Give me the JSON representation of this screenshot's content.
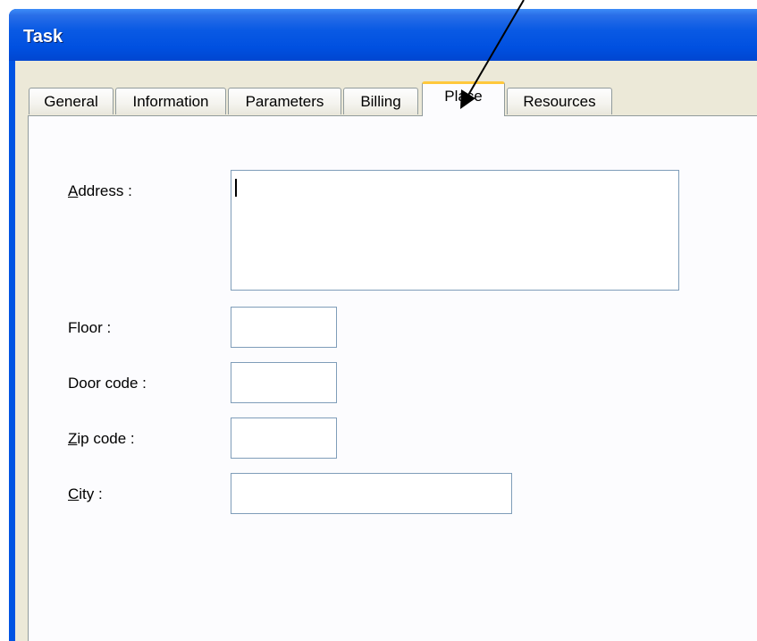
{
  "window": {
    "title": "Task"
  },
  "tabs": [
    {
      "label": "General"
    },
    {
      "label": "Information"
    },
    {
      "label": "Parameters"
    },
    {
      "label": "Billing"
    },
    {
      "label": "Place",
      "active": true
    },
    {
      "label": "Resources"
    }
  ],
  "form": {
    "address": {
      "accel": "A",
      "rest": "ddress :",
      "value": ""
    },
    "floor": {
      "label": "Floor :",
      "value": ""
    },
    "door_code": {
      "label": "Door code :",
      "value": ""
    },
    "zip_code": {
      "accel": "Z",
      "rest": "ip code :",
      "value": ""
    },
    "city": {
      "accel": "C",
      "rest": "ity :",
      "value": ""
    }
  },
  "colors": {
    "titlebar": "#0054e3",
    "active_tab_highlight": "#ffc83c",
    "dialog_face": "#ece9d8",
    "input_border": "#7f9db9"
  }
}
